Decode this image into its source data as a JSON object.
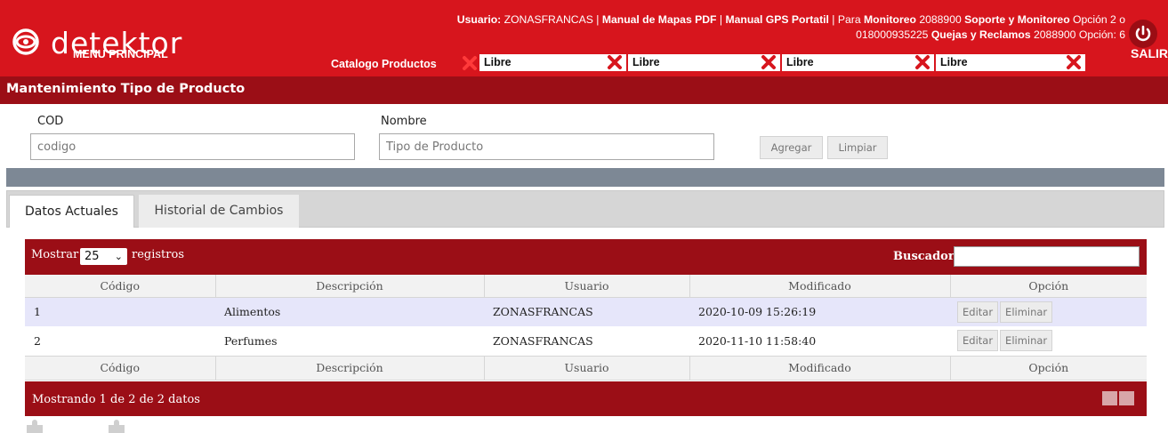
{
  "header": {
    "logo_text": "detektor",
    "menu_label": "MENU PRINCIPAL",
    "usuario_label": "Usuario:",
    "usuario_value": "ZONASFRANCAS",
    "sep": " | ",
    "manual_mapas": "Manual de Mapas PDF",
    "manual_gps": "Manual GPS Portatil",
    "para": "Para",
    "monitoreo_label": "Monitoreo",
    "monitoreo_phone": "2088900",
    "soporte_label": "Soporte y Monitoreo",
    "soporte_tail": "Opción 2 o 018000935225",
    "quejas_label": "Quejas y Reclamos",
    "quejas_tail": "2088900 Opción: 6",
    "salir_label": "SALIR"
  },
  "tab_slots": {
    "active_label": "Catalogo Productos",
    "slots": [
      "Libre",
      "Libre",
      "Libre",
      "Libre"
    ]
  },
  "section": {
    "title": "Mantenimiento Tipo de Producto"
  },
  "form": {
    "cod_label": "COD",
    "cod_placeholder": "codigo",
    "nombre_label": "Nombre",
    "nombre_placeholder": "Tipo de Producto",
    "add_button": "Agregar",
    "clear_button": "Limpiar"
  },
  "tabs": {
    "current": "Datos Actuales",
    "history": "Historial de Cambios"
  },
  "table": {
    "show_label": "Mostrar",
    "page_size": "25",
    "records_label": "registros",
    "search_label": "Buscador:",
    "columns": [
      "Código",
      "Descripción",
      "Usuario",
      "Modificado",
      "Opción"
    ],
    "rows": [
      {
        "codigo": "1",
        "descripcion": "Alimentos",
        "usuario": "ZONASFRANCAS",
        "modificado": "2020-10-09 15:26:19"
      },
      {
        "codigo": "2",
        "descripcion": "Perfumes",
        "usuario": "ZONASFRANCAS",
        "modificado": "2020-11-10 11:58:40"
      }
    ],
    "edit_label": "Editar",
    "delete_label": "Eliminar",
    "showing_text": "Mostrando 1 de 2 de 2 datos"
  },
  "colors": {
    "brand_red": "#d7151d",
    "dark_red": "#9b0e16",
    "slate": "#7d8895",
    "row_highlight": "#e6e6fa"
  }
}
